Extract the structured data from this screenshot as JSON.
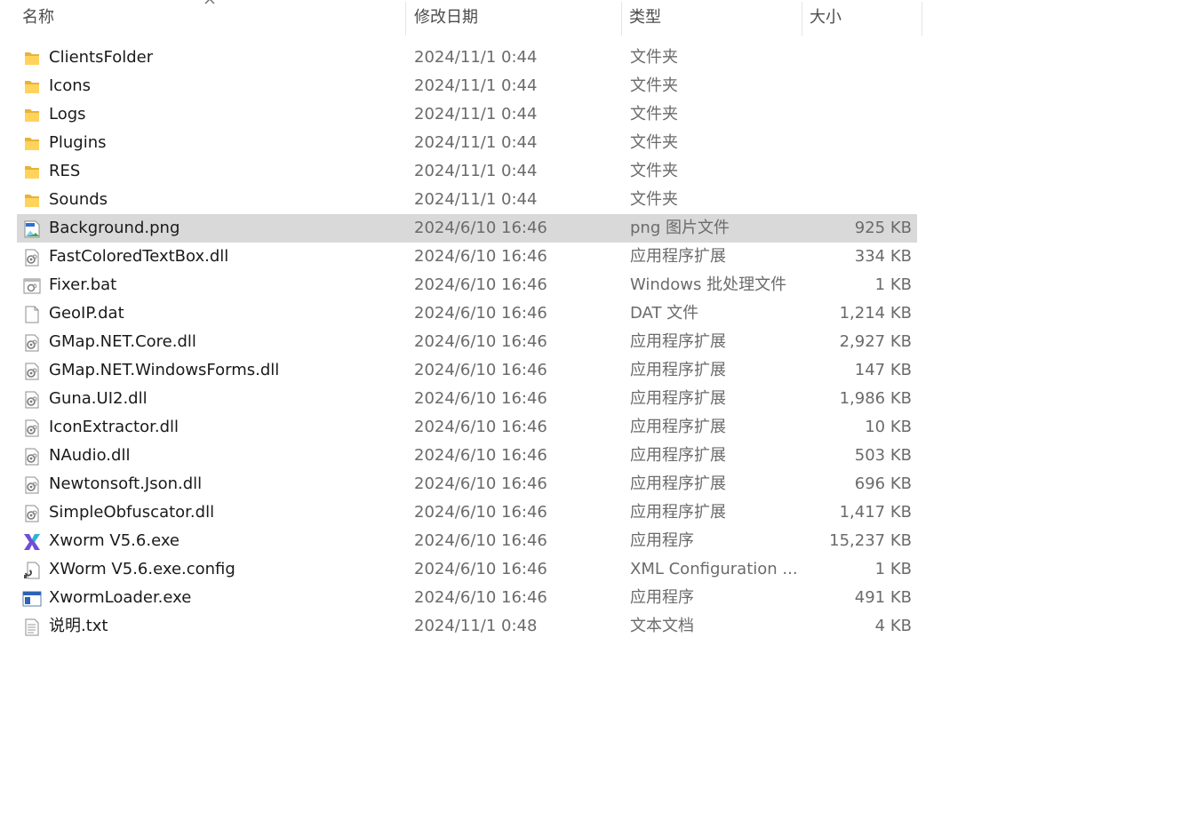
{
  "header": {
    "name": "名称",
    "date": "修改日期",
    "type": "类型",
    "size": "大小"
  },
  "files": [
    {
      "name": "ClientsFolder",
      "date": "2024/11/1 0:44",
      "type": "文件夹",
      "size": "",
      "icon": "folder-icon"
    },
    {
      "name": "Icons",
      "date": "2024/11/1 0:44",
      "type": "文件夹",
      "size": "",
      "icon": "folder-icon"
    },
    {
      "name": "Logs",
      "date": "2024/11/1 0:44",
      "type": "文件夹",
      "size": "",
      "icon": "folder-icon"
    },
    {
      "name": "Plugins",
      "date": "2024/11/1 0:44",
      "type": "文件夹",
      "size": "",
      "icon": "folder-icon"
    },
    {
      "name": "RES",
      "date": "2024/11/1 0:44",
      "type": "文件夹",
      "size": "",
      "icon": "folder-icon"
    },
    {
      "name": "Sounds",
      "date": "2024/11/1 0:44",
      "type": "文件夹",
      "size": "",
      "icon": "folder-icon"
    },
    {
      "name": "Background.png",
      "date": "2024/6/10 16:46",
      "type": "png 图片文件",
      "size": "925 KB",
      "icon": "image-file-icon",
      "selected": true
    },
    {
      "name": "FastColoredTextBox.dll",
      "date": "2024/6/10 16:46",
      "type": "应用程序扩展",
      "size": "334 KB",
      "icon": "dll-file-icon"
    },
    {
      "name": "Fixer.bat",
      "date": "2024/6/10 16:46",
      "type": "Windows 批处理文件",
      "size": "1 KB",
      "icon": "batch-file-icon"
    },
    {
      "name": "GeoIP.dat",
      "date": "2024/6/10 16:46",
      "type": "DAT 文件",
      "size": "1,214 KB",
      "icon": "blank-file-icon"
    },
    {
      "name": "GMap.NET.Core.dll",
      "date": "2024/6/10 16:46",
      "type": "应用程序扩展",
      "size": "2,927 KB",
      "icon": "dll-file-icon"
    },
    {
      "name": "GMap.NET.WindowsForms.dll",
      "date": "2024/6/10 16:46",
      "type": "应用程序扩展",
      "size": "147 KB",
      "icon": "dll-file-icon"
    },
    {
      "name": "Guna.UI2.dll",
      "date": "2024/6/10 16:46",
      "type": "应用程序扩展",
      "size": "1,986 KB",
      "icon": "dll-file-icon"
    },
    {
      "name": "IconExtractor.dll",
      "date": "2024/6/10 16:46",
      "type": "应用程序扩展",
      "size": "10 KB",
      "icon": "dll-file-icon"
    },
    {
      "name": "NAudio.dll",
      "date": "2024/6/10 16:46",
      "type": "应用程序扩展",
      "size": "503 KB",
      "icon": "dll-file-icon"
    },
    {
      "name": "Newtonsoft.Json.dll",
      "date": "2024/6/10 16:46",
      "type": "应用程序扩展",
      "size": "696 KB",
      "icon": "dll-file-icon"
    },
    {
      "name": "SimpleObfuscator.dll",
      "date": "2024/6/10 16:46",
      "type": "应用程序扩展",
      "size": "1,417 KB",
      "icon": "dll-file-icon"
    },
    {
      "name": "Xworm V5.6.exe",
      "date": "2024/6/10 16:46",
      "type": "应用程序",
      "size": "15,237 KB",
      "icon": "xworm-app-icon"
    },
    {
      "name": "XWorm V5.6.exe.config",
      "date": "2024/6/10 16:46",
      "type": "XML Configuration ...",
      "size": "1 KB",
      "icon": "config-file-icon"
    },
    {
      "name": "XwormLoader.exe",
      "date": "2024/6/10 16:46",
      "type": "应用程序",
      "size": "491 KB",
      "icon": "exe-window-icon"
    },
    {
      "name": "说明.txt",
      "date": "2024/11/1 0:48",
      "type": "文本文档",
      "size": "4 KB",
      "icon": "text-file-icon"
    }
  ]
}
